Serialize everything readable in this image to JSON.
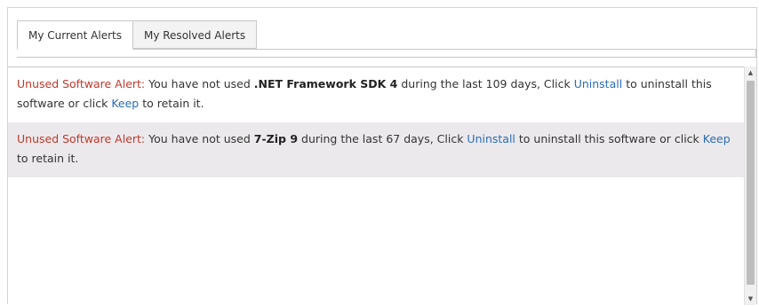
{
  "tabs": [
    {
      "label": "My Current Alerts",
      "active": true
    },
    {
      "label": "My Resolved Alerts",
      "active": false
    }
  ],
  "alerts": [
    {
      "label": "Unused Software Alert:",
      "t1": "You have not used",
      "software": ".NET Framework SDK 4",
      "t2": "during the last 109 days, Click",
      "uninstall": "Uninstall",
      "t3": "to uninstall this software or click",
      "keep": "Keep",
      "t4": "to retain it."
    },
    {
      "label": "Unused Software Alert:",
      "t1": "You have not used",
      "software": "7-Zip 9",
      "t2": "during the last 67 days, Click",
      "uninstall": "Uninstall",
      "t3": "to uninstall this software or click",
      "keep": "Keep",
      "t4": "to retain it."
    }
  ],
  "scrollbar": {
    "up_icon": "▲",
    "down_icon": "▼"
  }
}
